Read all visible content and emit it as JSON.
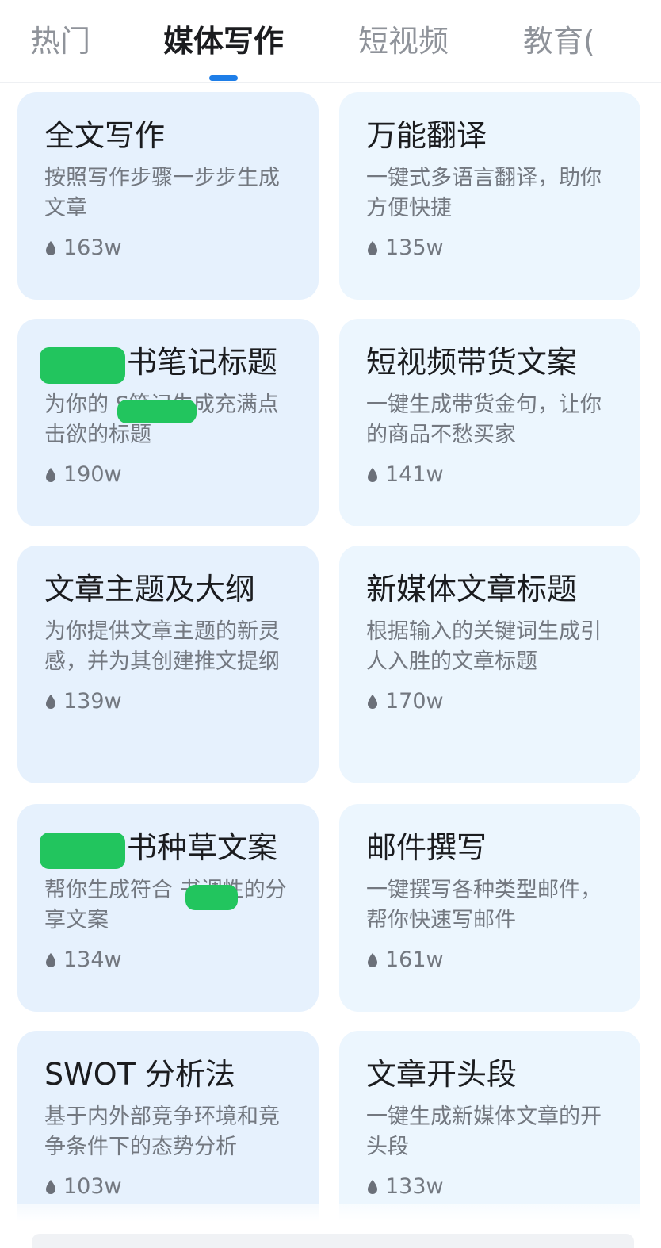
{
  "tabs": [
    {
      "label": "热门",
      "active": false
    },
    {
      "label": "媒体写作",
      "active": true
    },
    {
      "label": "短视频",
      "active": false
    },
    {
      "label": "教育(",
      "active": false
    }
  ],
  "colors": {
    "accent": "#1e7ee8",
    "card_left": "#e6f1fd",
    "card_right": "#ecf6fe",
    "redaction": "#22c55e"
  },
  "cards": [
    {
      "title": "全文写作",
      "desc": "按照写作步骤一步步生成文章",
      "count": "163w",
      "redacted_title": false
    },
    {
      "title": "万能翻译",
      "desc": "一键式多语言翻译，助你方便快捷",
      "count": "135w",
      "redacted_title": false
    },
    {
      "title": "书笔记标题",
      "desc": "为你的      S笔记生成充满点击欲的标题",
      "count": "190w",
      "redacted_title": true
    },
    {
      "title": "短视频带货文案",
      "desc": "一键生成带货金句，让你的商品不愁买家",
      "count": "141w",
      "redacted_title": false
    },
    {
      "title": "文章主题及大纲",
      "desc": "为你提供文章主题的新灵感，并为其创建推文提纲",
      "count": "139w",
      "redacted_title": false
    },
    {
      "title": "新媒体文章标题",
      "desc": "根据输入的关键词生成引人入胜的文章标题",
      "count": "170w",
      "redacted_title": false
    },
    {
      "title": "书种草文案",
      "desc": "帮你生成符合      书调性的分享文案",
      "count": "134w",
      "redacted_title": true
    },
    {
      "title": "邮件撰写",
      "desc": "一键撰写各种类型邮件，帮你快速写邮件",
      "count": "161w",
      "redacted_title": false
    },
    {
      "title": "SWOT 分析法",
      "desc": "基于内外部竞争环境和竞争条件下的态势分析",
      "count": "103w",
      "redacted_title": false
    },
    {
      "title": "文章开头段",
      "desc": "一键生成新媒体文章的开头段",
      "count": "133w",
      "redacted_title": false
    }
  ],
  "icons": {
    "count_icon": "flame-icon"
  }
}
